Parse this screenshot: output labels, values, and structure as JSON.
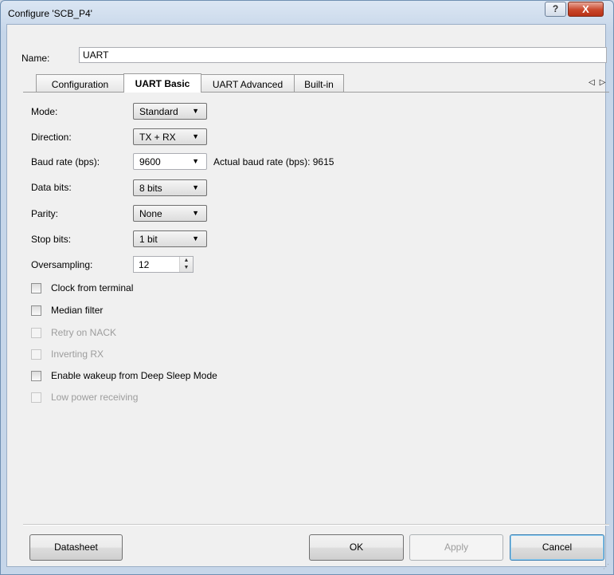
{
  "window": {
    "title": "Configure 'SCB_P4'",
    "help_label": "?",
    "close_label": "X"
  },
  "name": {
    "label": "Name:",
    "value": "UART"
  },
  "tabs": [
    {
      "label": "Configuration"
    },
    {
      "label": "UART Basic"
    },
    {
      "label": "UART Advanced"
    },
    {
      "label": "Built-in"
    }
  ],
  "tab_scroll": {
    "left": "◁",
    "right": "▷"
  },
  "fields": {
    "mode": {
      "label": "Mode:",
      "value": "Standard"
    },
    "direction": {
      "label": "Direction:",
      "value": "TX + RX"
    },
    "baud": {
      "label": "Baud rate (bps):",
      "value": "9600",
      "actual": "Actual baud rate (bps): 9615"
    },
    "data_bits": {
      "label": "Data bits:",
      "value": "8 bits"
    },
    "parity": {
      "label": "Parity:",
      "value": "None"
    },
    "stop_bits": {
      "label": "Stop bits:",
      "value": "1 bit"
    },
    "oversampling": {
      "label": "Oversampling:",
      "value": "12"
    }
  },
  "checkboxes": [
    {
      "label": "Clock from terminal",
      "enabled": true,
      "checked": false
    },
    {
      "label": "Median filter",
      "enabled": true,
      "checked": false
    },
    {
      "label": "Retry on NACK",
      "enabled": false,
      "checked": false
    },
    {
      "label": "Inverting RX",
      "enabled": false,
      "checked": false
    },
    {
      "label": "Enable wakeup from Deep Sleep Mode",
      "enabled": true,
      "checked": false
    },
    {
      "label": "Low power receiving",
      "enabled": false,
      "checked": false
    }
  ],
  "buttons": {
    "datasheet": "Datasheet",
    "ok": "OK",
    "apply": "Apply",
    "cancel": "Cancel"
  },
  "colors": {
    "title_bg": "#dbe6f3",
    "close_red": "#c9472b",
    "client_bg": "#f0f0f0",
    "disabled_text": "#9d9d9d"
  }
}
